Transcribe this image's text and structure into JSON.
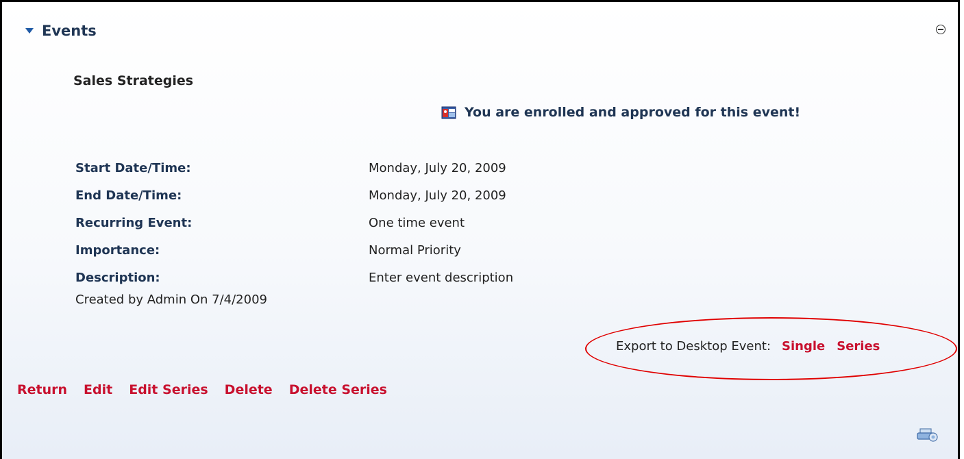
{
  "header": {
    "title": "Events"
  },
  "event": {
    "name": "Sales Strategies",
    "status_message": "You are enrolled and approved for this event!",
    "fields": [
      {
        "label": "Start Date/Time:",
        "value": "Monday, July 20, 2009"
      },
      {
        "label": "End Date/Time:",
        "value": "Monday, July 20, 2009"
      },
      {
        "label": "Recurring Event:",
        "value": "One time event"
      },
      {
        "label": "Importance:",
        "value": "Normal Priority"
      },
      {
        "label": "Description:",
        "value": "Enter event description"
      }
    ],
    "created": "Created by Admin On 7/4/2009"
  },
  "export": {
    "label": "Export to Desktop Event:",
    "single": "Single",
    "series": "Series"
  },
  "actions": [
    "Return",
    "Edit",
    "Edit Series",
    "Delete",
    "Delete Series"
  ],
  "colors": {
    "link": "#c8102e",
    "heading": "#1f3554",
    "annotation": "#e00000"
  },
  "icons": {
    "header": "collapse-triangle-icon",
    "minimize": "minimize-icon",
    "status": "event-enrolled-icon",
    "bottom": "print-icon"
  }
}
